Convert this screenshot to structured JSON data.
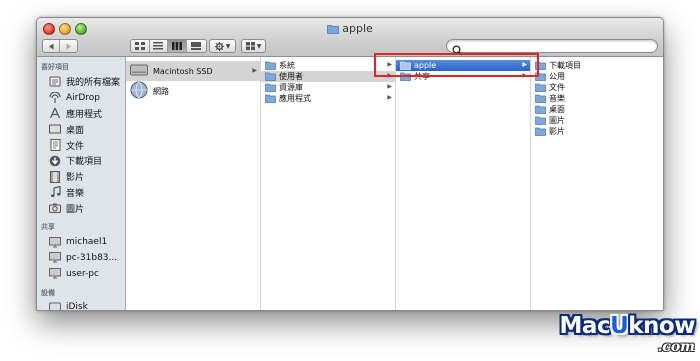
{
  "window": {
    "title": "apple",
    "nav_back_icon": "triangle-left",
    "nav_forward_icon": "triangle-right",
    "view_modes": [
      "icon-view",
      "list-view",
      "column-view",
      "cover-flow-view"
    ],
    "active_view": "column-view",
    "action_menu_icon": "gear",
    "arrange_icon": "grid",
    "search_placeholder": ""
  },
  "sidebar": {
    "sections": [
      {
        "header": "喜好項目",
        "items": [
          {
            "label": "我的所有檔案",
            "icon": "all-files"
          },
          {
            "label": "AirDrop",
            "icon": "airdrop"
          },
          {
            "label": "應用程式",
            "icon": "applications"
          },
          {
            "label": "桌面",
            "icon": "desktop"
          },
          {
            "label": "文件",
            "icon": "documents"
          },
          {
            "label": "下載項目",
            "icon": "downloads"
          },
          {
            "label": "影片",
            "icon": "movies"
          },
          {
            "label": "音樂",
            "icon": "music"
          },
          {
            "label": "圖片",
            "icon": "pictures"
          }
        ]
      },
      {
        "header": "共享",
        "items": [
          {
            "label": "michael1",
            "icon": "computer"
          },
          {
            "label": "pc-31b83...",
            "icon": "computer"
          },
          {
            "label": "user-pc",
            "icon": "computer"
          }
        ]
      },
      {
        "header": "設備",
        "items": [
          {
            "label": "iDisk",
            "icon": "idisk"
          }
        ]
      }
    ]
  },
  "columns": {
    "col1": [
      {
        "label": "Macintosh SSD",
        "icon": "hard-drive"
      },
      {
        "label": "網路",
        "icon": "network"
      }
    ],
    "col2": [
      "系統",
      "使用者",
      "資源庫",
      "應用程式"
    ],
    "col3": [
      "apple",
      "共享"
    ],
    "col4": [
      "下載項目",
      "公用",
      "文件",
      "音樂",
      "桌面",
      "圖片",
      "影片"
    ]
  },
  "colors": {
    "selection_blue": "#2a62c9",
    "selection_gray": "#d4d4d4",
    "sidebar_bg": "#dee4ea",
    "highlight_red": "#e02424",
    "folder_blue": "#7fa8d8"
  },
  "watermark": {
    "main_pre": "Mac",
    "main_u": "U",
    "main_post": "know",
    "sub": ".com"
  }
}
